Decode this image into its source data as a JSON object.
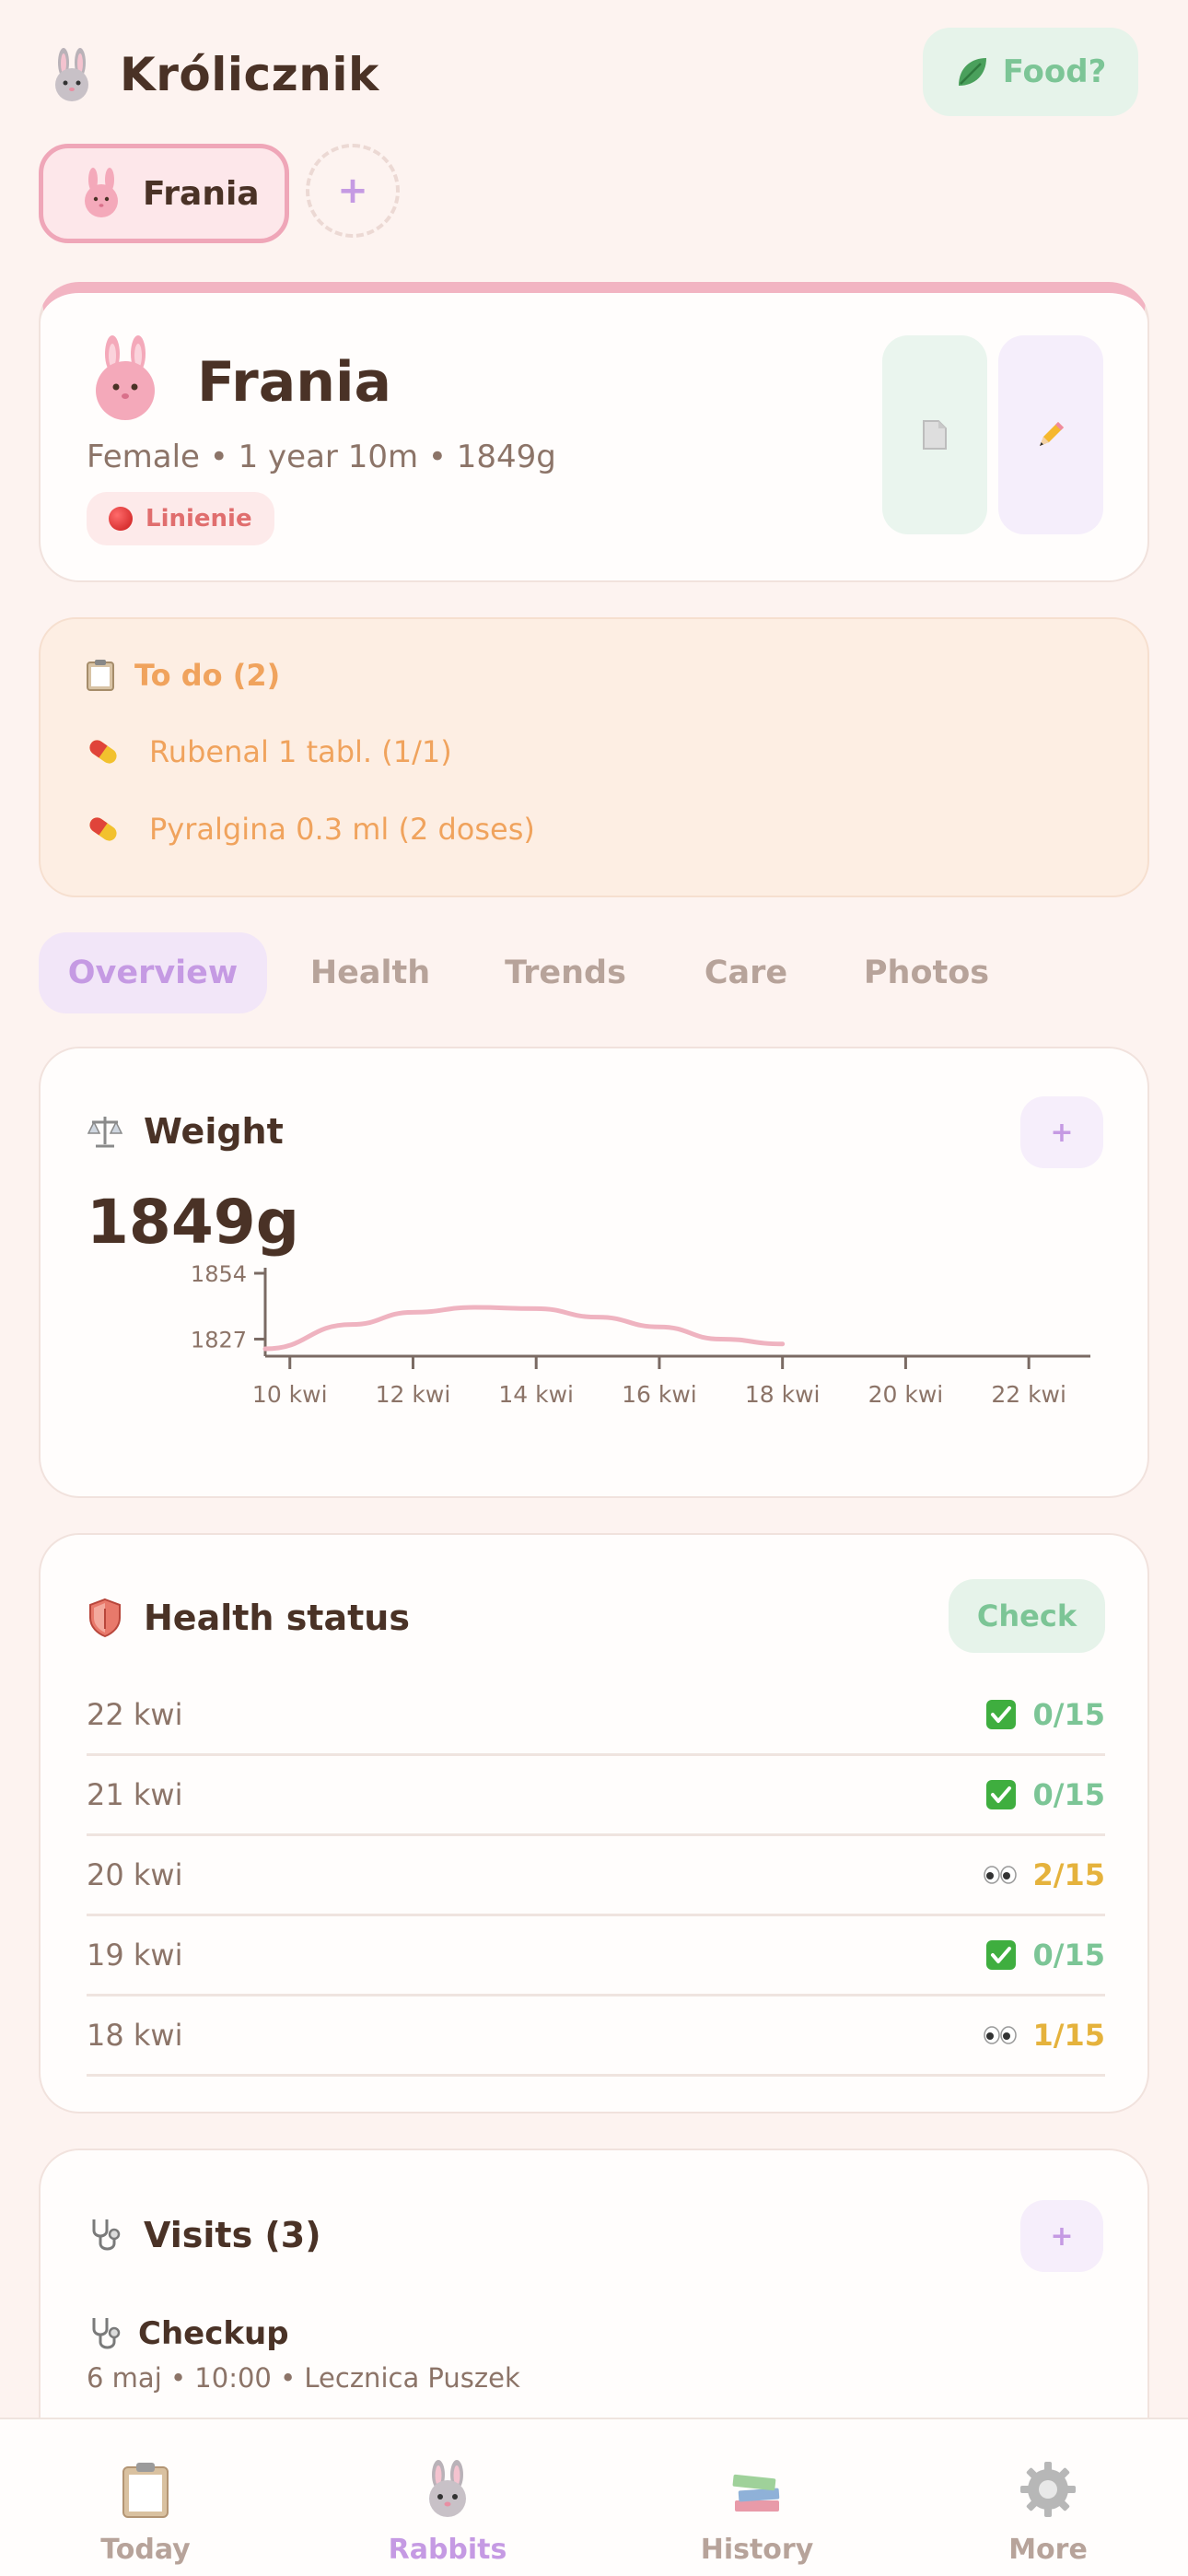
{
  "header": {
    "title": "Królicznik",
    "food_label": "Food?"
  },
  "rabbits": {
    "selected": "Frania",
    "add_label": "+"
  },
  "profile": {
    "name": "Frania",
    "meta": "Female • 1 year 10m • 1849g",
    "status": "Linienie"
  },
  "todo": {
    "title": "To do (2)",
    "items": [
      "Rubenal 1 tabl. (1/1)",
      "Pyralgina 0.3 ml (2 doses)"
    ]
  },
  "tabs": [
    "Overview",
    "Health",
    "Trends",
    "Care",
    "Photos"
  ],
  "active_tab": "Overview",
  "weight": {
    "title": "Weight",
    "add_label": "+",
    "current": "1849g"
  },
  "chart_data": {
    "type": "line",
    "title": "",
    "xlabel": "",
    "ylabel": "",
    "x_ticks": [
      "10 kwi",
      "12 kwi",
      "14 kwi",
      "16 kwi",
      "18 kwi",
      "20 kwi",
      "22 kwi"
    ],
    "y_ticks": [
      1827,
      1854
    ],
    "series": [
      {
        "x": [
          9.6,
          11,
          12,
          13,
          14,
          15,
          16,
          17,
          18.0
        ],
        "values": [
          1823,
          1833,
          1838,
          1840,
          1839.5,
          1836,
          1832,
          1827,
          1825
        ],
        "color": "#efb3c0"
      }
    ],
    "xlim": [
      9.6,
      23.0
    ],
    "ylim": [
      1820,
      1854
    ],
    "grid": false
  },
  "health": {
    "title": "Health status",
    "check_label": "Check",
    "rows": [
      {
        "date": "22 kwi",
        "score": "0/15",
        "state": "ok"
      },
      {
        "date": "21 kwi",
        "score": "0/15",
        "state": "ok"
      },
      {
        "date": "20 kwi",
        "score": "2/15",
        "state": "warn"
      },
      {
        "date": "19 kwi",
        "score": "0/15",
        "state": "ok"
      },
      {
        "date": "18 kwi",
        "score": "1/15",
        "state": "warn"
      }
    ]
  },
  "visits": {
    "title": "Visits (3)",
    "add_label": "+",
    "first": {
      "title": "Checkup",
      "meta": "6 maj • 10:00 • Lecznica Puszek"
    }
  },
  "nav": {
    "items": [
      "Today",
      "Rabbits",
      "History",
      "More"
    ],
    "active": "Rabbits"
  },
  "colors": {
    "accent": "#c59ae3",
    "pink": "#efa6b8",
    "green": "#7cc596",
    "orange": "#f0a35d",
    "yellow": "#e5b23c",
    "text": "#4a3226"
  },
  "icons": [
    "rabbit-icon",
    "leaf-icon",
    "document-icon",
    "pencil-icon",
    "clipboard-icon",
    "pill-icon",
    "scale-icon",
    "shield-icon",
    "checkbox-icon",
    "eyes-icon",
    "stethoscope-icon",
    "gear-icon",
    "books-icon"
  ]
}
